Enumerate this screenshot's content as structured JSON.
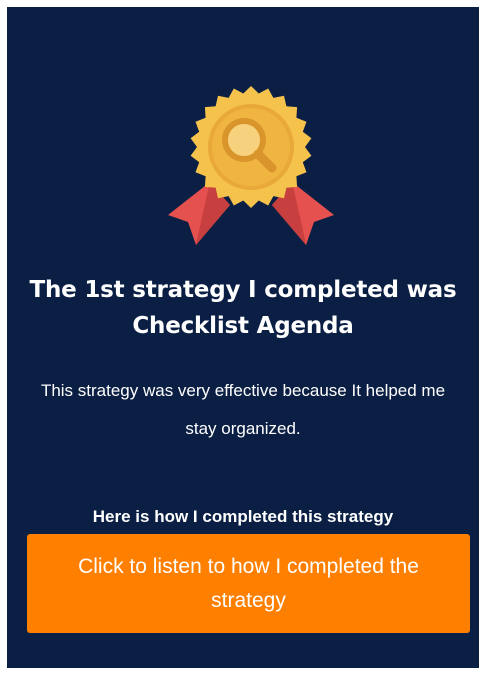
{
  "badge": {
    "icon": "award-ribbon-badge-icon",
    "inner_icon": "magnifying-glass-icon",
    "colors": {
      "ribbon": "#e5514f",
      "ribbon_dark": "#c73f3f",
      "medal": "#f5c24c",
      "medal_inner": "#e8a93a",
      "lens": "#f7d27e"
    }
  },
  "title": "The 1st strategy I completed was Checklist Agenda",
  "description": "This strategy was very effective because It helped me stay organized.",
  "how_label": "Here is how I completed this strategy",
  "listen_button": {
    "label": "Click to listen to how I completed the strategy"
  },
  "colors": {
    "background": "#0b1f44",
    "accent": "#ff7f00",
    "text": "#ffffff"
  }
}
